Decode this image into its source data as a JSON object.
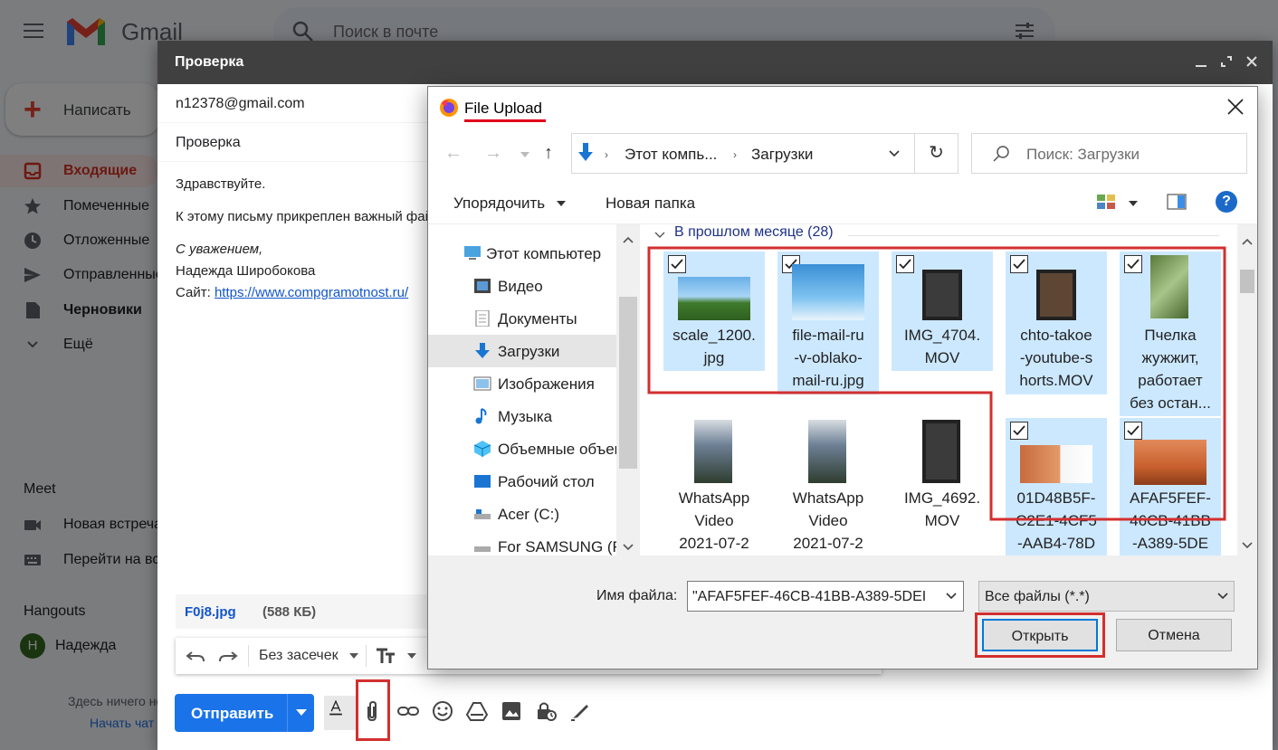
{
  "gmail": {
    "logo_text": "Gmail",
    "search_placeholder": "Поиск в почте",
    "compose_label": "Написать",
    "nav": [
      {
        "label": "Входящие",
        "icon": "inbox-icon"
      },
      {
        "label": "Помеченные",
        "icon": "star-icon"
      },
      {
        "label": "Отложенные",
        "icon": "clock-icon"
      },
      {
        "label": "Отправленные",
        "icon": "send-icon"
      },
      {
        "label": "Черновики",
        "icon": "draft-icon"
      },
      {
        "label": "Ещё",
        "icon": "chevron-down-icon"
      }
    ],
    "meet_title": "Meet",
    "meet_items": [
      {
        "label": "Новая встреча",
        "icon": "video-icon"
      },
      {
        "label": "Перейти на встречу",
        "icon": "keyboard-icon"
      }
    ],
    "hangouts_title": "Hangouts",
    "hangouts_user": "Надежда",
    "hangouts_initial": "Н",
    "hangouts_empty": "Здесь ничего нет",
    "hangouts_start": "Начать чат"
  },
  "compose": {
    "title": "Проверка",
    "to": "n12378@gmail.com",
    "subject": "Проверка",
    "body": {
      "greeting": "Здравствуйте.",
      "line1": "К этому письму прикреплен важный файл",
      "closing": "С уважением,",
      "name": "Надежда Широбокова",
      "site_label": "Сайт:",
      "site_link": "https://www.compgramotnost.ru/"
    },
    "attachment": {
      "name": "F0j8.jpg",
      "size": "(588 КБ)"
    },
    "format_font": "Без засечек",
    "send_label": "Отправить"
  },
  "dialog": {
    "title": "File Upload",
    "breadcrumb": [
      "Этот компь...",
      "Загрузки"
    ],
    "search_placeholder": "Поиск: Загрузки",
    "organize_label": "Упорядочить",
    "new_folder_label": "Новая папка",
    "help_label": "?",
    "nav_items": [
      {
        "label": "Этот компьютер",
        "icon": "computer-icon"
      },
      {
        "label": "Видео",
        "icon": "video-folder-icon"
      },
      {
        "label": "Документы",
        "icon": "documents-icon"
      },
      {
        "label": "Загрузки",
        "icon": "downloads-icon",
        "selected": true
      },
      {
        "label": "Изображения",
        "icon": "images-icon"
      },
      {
        "label": "Музыка",
        "icon": "music-icon"
      },
      {
        "label": "Объемные объекты",
        "icon": "3d-objects-icon"
      },
      {
        "label": "Рабочий стол",
        "icon": "desktop-icon"
      },
      {
        "label": "Acer (C:)",
        "icon": "drive-icon"
      },
      {
        "label": "For SAMSUNG (F:)",
        "icon": "drive-icon"
      }
    ],
    "group_label": "В прошлом месяце (28)",
    "files": [
      {
        "lines": [
          "scale_1200.",
          "jpg"
        ],
        "selected": true,
        "thumb": "flowers"
      },
      {
        "lines": [
          "file-mail-ru",
          "-v-oblako-",
          "mail-ru.jpg"
        ],
        "selected": true,
        "thumb": "cloud"
      },
      {
        "lines": [
          "IMG_4704.",
          "MOV"
        ],
        "selected": true,
        "thumb": "tablet"
      },
      {
        "lines": [
          "chto-takoe",
          "-youtube-s",
          "horts.MOV"
        ],
        "selected": true,
        "thumb": "tablet"
      },
      {
        "lines": [
          "Пчелка",
          "жужжит,",
          "работает",
          "без остан..."
        ],
        "selected": true,
        "thumb": "plant"
      },
      {
        "lines": [
          "WhatsApp",
          "Video",
          "2021-07-2"
        ],
        "selected": false,
        "thumb": "river"
      },
      {
        "lines": [
          "WhatsApp",
          "Video",
          "2021-07-2"
        ],
        "selected": false,
        "thumb": "river"
      },
      {
        "lines": [
          "IMG_4692.",
          "MOV"
        ],
        "selected": false,
        "thumb": "tablet"
      },
      {
        "lines": [
          "01D48B5F-",
          "C2E1-4CF5",
          "-AAB4-78D"
        ],
        "selected": true,
        "thumb": "room"
      },
      {
        "lines": [
          "AFAF5FEF-",
          "46CB-41BB",
          "-A389-5DE"
        ],
        "selected": true,
        "thumb": "room2"
      }
    ],
    "filename_label": "Имя файла:",
    "filename_value": "\"AFAF5FEF-46CB-41BB-A389-5DEI",
    "filetype_value": "Все файлы (*.*)",
    "open_label": "Открыть",
    "cancel_label": "Отмена"
  },
  "colors": {
    "highlight_red": "#d32f2f",
    "gmail_blue": "#1a73e8",
    "selection_blue": "#cce8ff"
  }
}
